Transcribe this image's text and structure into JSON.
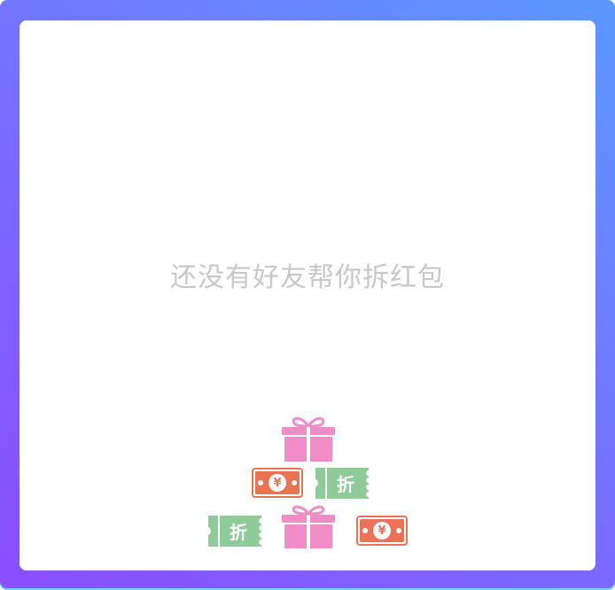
{
  "empty_state": {
    "message": "还没有好友帮你拆红包"
  },
  "decorations": {
    "gift_icon": "gift-icon",
    "coupon_icon": "coupon-icon",
    "cash_icon": "cash-icon",
    "coupon_label": "折",
    "cash_symbol": "¥"
  },
  "colors": {
    "gift": "#f08dc6",
    "coupon": "#8fcb99",
    "cash": "#ec7254",
    "frame_start": "#5b98ff",
    "frame_end": "#8a4dff",
    "empty_text": "#c8c8c8"
  }
}
